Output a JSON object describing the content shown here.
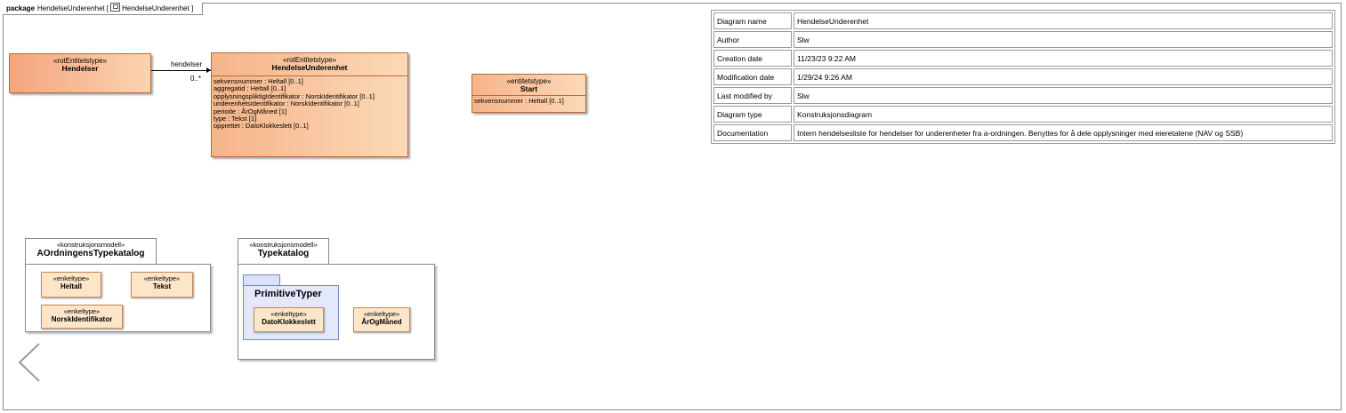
{
  "frame": {
    "keyword": "package",
    "name": "HendelseUnderenhet",
    "diagram_ref": "HendelseUnderenhet",
    "bracket_open": "[",
    "bracket_close": "]"
  },
  "classes": {
    "hendelser": {
      "stereotype": "«rotEntitetstype»",
      "name": "Hendelser"
    },
    "hendelse_underenhet": {
      "stereotype": "«rotEntitetstype»",
      "name": "HendelseUnderenhet",
      "attributes": [
        "sekvensnummer : Heltall [0..1]",
        "aggregatid : Heltall [0..1]",
        "opplysningspliktigIdentifikator : NorskIdentifikator [0..1]",
        "underenhetsIdentifikator : NorskIdentifikator [0..1]",
        "periode : ÅrOgMåned [1]",
        "type : Tekst [1]",
        "opprettet : DatoKlokkeslett [0..1]"
      ]
    },
    "start": {
      "stereotype": "«entitetstype»",
      "name": "Start",
      "attributes": [
        "sekvensnummer : Heltall [0..1]"
      ]
    }
  },
  "association": {
    "role": "hendelser",
    "multiplicity": "0..*"
  },
  "packages": {
    "aordning": {
      "stereotype": "«konstruksjonsmodell»",
      "name": "AOrdningensTypekatalog",
      "types": [
        {
          "stereotype": "«enkeltype»",
          "name": "Heltall"
        },
        {
          "stereotype": "«enkeltype»",
          "name": "Tekst"
        },
        {
          "stereotype": "«enkeltype»",
          "name": "NorskIdentifikator"
        }
      ]
    },
    "typekatalog": {
      "stereotype": "«konstruksjonsmodell»",
      "name": "Typekatalog",
      "subpackage": "PrimitiveTyper",
      "types": [
        {
          "stereotype": "«enkeltype»",
          "name": "DatoKlokkeslett"
        },
        {
          "stereotype": "«enkeltype»",
          "name": "ÅrOgMåned"
        }
      ]
    }
  },
  "info_table": [
    {
      "key": "Diagram name",
      "value": "HendelseUnderenhet"
    },
    {
      "key": "Author",
      "value": "Slw"
    },
    {
      "key": "Creation date",
      "value": "11/23/23 9:22 AM"
    },
    {
      "key": "Modification date",
      "value": "1/29/24 9:26 AM"
    },
    {
      "key": "Last modified by",
      "value": "Slw"
    },
    {
      "key": "Diagram type",
      "value": "Konstruksjonsdiagram"
    },
    {
      "key": "Documentation",
      "value": "Intern hendelsesliste for hendelser for underenheter fra a-ordningen. Benyttes for å dele opplysninger med eieretatene (NAV og SSB)"
    }
  ],
  "colors": {
    "class_fill_start": "#f4a57e",
    "class_fill_end": "#fbd3b0",
    "enkeltype_fill": "#fde5c8",
    "primitive_package_fill": "#e3e9fb"
  },
  "icons": {
    "diagram_ref": "diagram-icon",
    "nav": "chevron-left-icon"
  }
}
